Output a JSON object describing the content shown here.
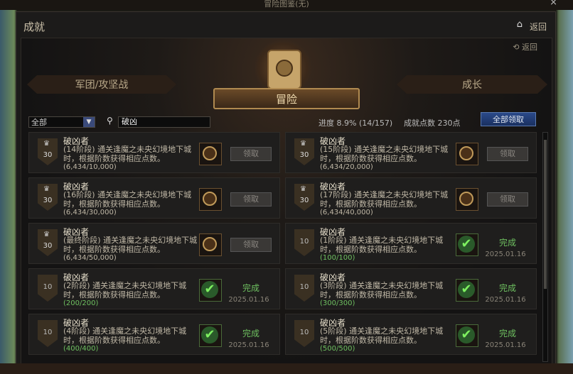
{
  "window": {
    "title": "冒险图鉴(无)",
    "close_icon": "×"
  },
  "header": {
    "title": "成就",
    "back_label": "返回"
  },
  "inner": {
    "back_label": "返回"
  },
  "tabs": {
    "left": "军团/攻坚战",
    "main": "冒险",
    "right": "成长"
  },
  "filter": {
    "dropdown_value": "全部",
    "search_value": "破凶"
  },
  "stats": {
    "progress": "进度  8.9% (14/157)",
    "points": "成就点数 230点"
  },
  "claim_all_label": "全部领取",
  "achievements": [
    {
      "title": "破凶者",
      "desc": "(14阶段) 通关逢魔之未央幻境地下城时，根据阶数获得相应点数。",
      "progress": "(6,434/10,000)",
      "points": "30",
      "done": false,
      "action": "领取"
    },
    {
      "title": "破凶者",
      "desc": "(15阶段) 通关逢魔之未央幻境地下城时，根据阶数获得相应点数。",
      "progress": "(6,434/20,000)",
      "points": "30",
      "done": false,
      "action": "领取"
    },
    {
      "title": "破凶者",
      "desc": "(16阶段) 通关逢魔之未央幻境地下城时，根据阶数获得相应点数。",
      "progress": "(6,434/30,000)",
      "points": "30",
      "done": false,
      "action": "领取"
    },
    {
      "title": "破凶者",
      "desc": "(17阶段) 通关逢魔之未央幻境地下城时，根据阶数获得相应点数。",
      "progress": "(6,434/40,000)",
      "points": "30",
      "done": false,
      "action": "领取"
    },
    {
      "title": "破凶者",
      "desc": "(最终阶段) 通关逢魔之未央幻境地下城时，根据阶数获得相应点数。",
      "progress": "(6,434/50,000)",
      "points": "30",
      "done": false,
      "action": "领取"
    },
    {
      "title": "破凶者",
      "desc": "(1阶段) 通关逢魔之未央幻境地下城时，根据阶数获得相应点数。",
      "progress": "(100/100)",
      "points": "10",
      "done": true,
      "action": "完成",
      "date": "2025.01.16"
    },
    {
      "title": "破凶者",
      "desc": "(2阶段) 通关逢魔之未央幻境地下城时，根据阶数获得相应点数。",
      "progress": "(200/200)",
      "points": "10",
      "done": true,
      "action": "完成",
      "date": "2025.01.16"
    },
    {
      "title": "破凶者",
      "desc": "(3阶段) 通关逢魔之未央幻境地下城时，根据阶数获得相应点数。",
      "progress": "(300/300)",
      "points": "10",
      "done": true,
      "action": "完成",
      "date": "2025.01.16"
    },
    {
      "title": "破凶者",
      "desc": "(4阶段) 通关逢魔之未央幻境地下城时，根据阶数获得相应点数。",
      "progress": "(400/400)",
      "points": "10",
      "done": true,
      "action": "完成",
      "date": "2025.01.16"
    },
    {
      "title": "破凶者",
      "desc": "(5阶段) 通关逢魔之未央幻境地下城时，根据阶数获得相应点数。",
      "progress": "(500/500)",
      "points": "10",
      "done": true,
      "action": "完成",
      "date": "2025.01.16"
    }
  ]
}
